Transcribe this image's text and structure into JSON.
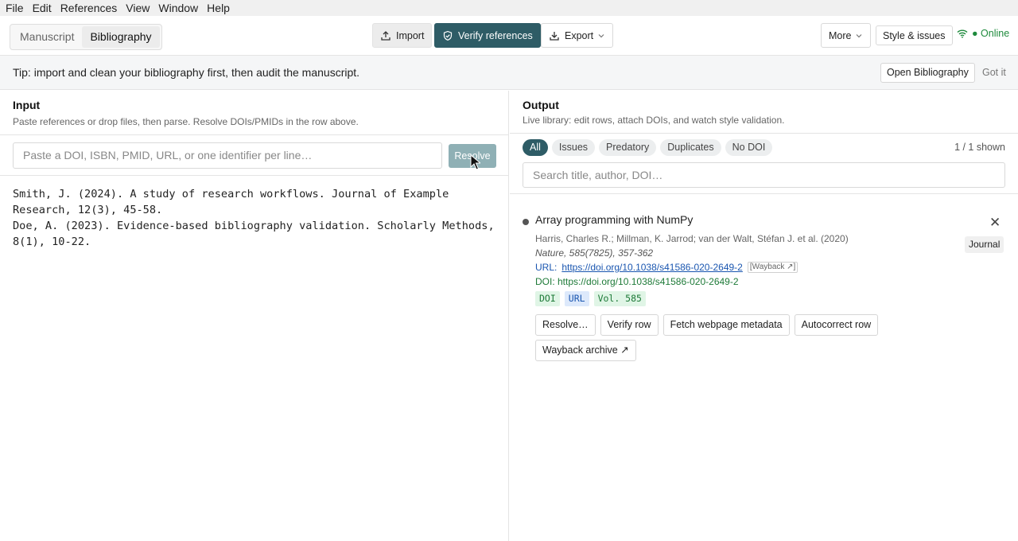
{
  "menu": [
    "File",
    "Edit",
    "References",
    "View",
    "Window",
    "Help"
  ],
  "tabs": {
    "manuscript": "Manuscript",
    "bibliography": "Bibliography"
  },
  "toolbar": {
    "import": "Import",
    "verify": "Verify references",
    "export": "Export",
    "more": "More",
    "style": "Style & issues",
    "online": "● Online"
  },
  "tip": {
    "text": "Tip: import and clean your bibliography first, then audit the manuscript.",
    "open": "Open Bibliography",
    "dismiss": "Got it"
  },
  "input": {
    "title": "Input",
    "subtitle": "Paste references or drop files, then parse. Resolve DOIs/PMIDs in the row above.",
    "placeholder": "Paste a DOI, ISBN, PMID, URL, or one identifier per line…",
    "resolve": "Resolve",
    "raw": "Smith, J. (2024). A study of research workflows. Journal of Example Research, 12(3), 45-58.\nDoe, A. (2023). Evidence-based bibliography validation. Scholarly Methods, 8(1), 10-22."
  },
  "output": {
    "title": "Output",
    "subtitle": "Live library: edit rows, attach DOIs, and watch style validation.",
    "filters": [
      "All",
      "Issues",
      "Predatory",
      "Duplicates",
      "No DOI"
    ],
    "shown": "1 / 1 shown",
    "search_placeholder": "Search title, author, DOI…"
  },
  "entry": {
    "title": "Array programming with NumPy",
    "authors": "Harris, Charles R.; Millman, K. Jarrod; van der Walt, Stéfan J. et al. (2020)",
    "journal": "Nature, 585(7825), 357-362",
    "url_label": "URL:",
    "url": "https://doi.org/10.1038/s41586-020-2649-2",
    "wayback": "[Wayback ↗]",
    "doi": "DOI: https://doi.org/10.1038/s41586-020-2649-2",
    "type": "Journal",
    "badges": [
      "DOI",
      "URL",
      "Vol. 585"
    ],
    "actions": [
      "Resolve…",
      "Verify row",
      "Fetch webpage metadata",
      "Autocorrect row",
      "Wayback archive ↗"
    ]
  },
  "colors": {
    "accent": "#2e5c66",
    "online": "#1e8a3c",
    "link": "#1a56b0",
    "doi": "#1e7a38"
  }
}
